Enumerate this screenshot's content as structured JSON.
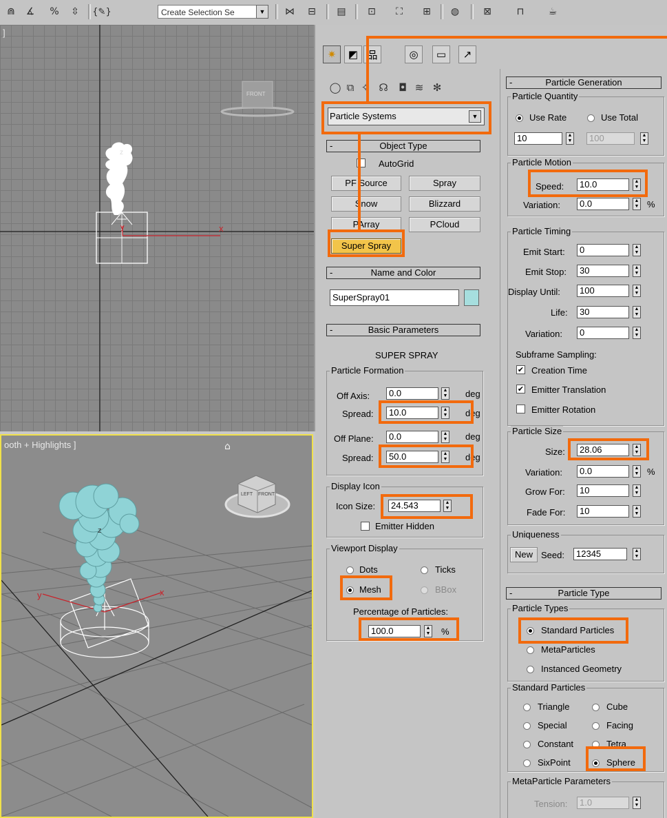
{
  "toolbar": {
    "selection_set_placeholder": "Create Selection Se",
    "icons": [
      "magnet-snap-icon",
      "angle-snap-icon",
      "percent-snap-icon",
      "spinner-snap-icon",
      "named-selection-edit-icon",
      "mirror-icon",
      "align-icon",
      "layer-manager-icon",
      "graphite-tools-icon",
      "curve-editor-icon",
      "schematic-view-icon",
      "material-editor-icon",
      "render-setup-icon",
      "rendered-frame-icon",
      "render-production-icon"
    ]
  },
  "viewports": {
    "front": {
      "label": "]",
      "axis_x": "x",
      "axis_y": "y",
      "axis_z": "z",
      "viewcube_label": "FRONT"
    },
    "perspective": {
      "label": "ooth + Highlights ]",
      "axis_x": "x",
      "axis_y": "y",
      "axis_z": "z",
      "viewcube_face_front": "FRONT",
      "viewcube_face_left": "LEFT"
    }
  },
  "command_panel": {
    "dropdown_value": "Particle Systems",
    "object_type": {
      "title": "Object Type",
      "autogrid_label": "AutoGrid",
      "buttons": [
        "PF Source",
        "Spray",
        "Snow",
        "Blizzard",
        "PArray",
        "PCloud",
        "Super Spray"
      ]
    },
    "name_color": {
      "title": "Name and Color",
      "name_value": "SuperSpray01",
      "color": "#a6dede"
    },
    "basic_params": {
      "title": "Basic Parameters",
      "heading": "SUPER SPRAY",
      "particle_formation": "Particle Formation",
      "off_axis_label": "Off Axis:",
      "off_axis_value": "0.0",
      "spread1_label": "Spread:",
      "spread1_value": "10.0",
      "off_plane_label": "Off Plane:",
      "off_plane_value": "0.0",
      "spread2_label": "Spread:",
      "spread2_value": "50.0",
      "deg": "deg",
      "display_icon": "Display Icon",
      "icon_size_label": "Icon Size:",
      "icon_size_value": "24.543",
      "emitter_hidden_label": "Emitter Hidden",
      "viewport_display": "Viewport Display",
      "dots": "Dots",
      "ticks": "Ticks",
      "mesh": "Mesh",
      "bbox": "BBox",
      "percentage_label": "Percentage of Particles:",
      "percentage_value": "100.0",
      "percent": "%"
    },
    "particle_generation": {
      "title": "Particle Generation",
      "quantity": "Particle Quantity",
      "use_rate": "Use Rate",
      "use_total": "Use Total",
      "rate_value": "10",
      "total_value": "100",
      "motion": "Particle Motion",
      "speed_label": "Speed:",
      "speed_value": "10.0",
      "variation_label": "Variation:",
      "variation_value": "0.0",
      "percent": "%",
      "timing": "Particle Timing",
      "emit_start_label": "Emit Start:",
      "emit_start_value": "0",
      "emit_stop_label": "Emit Stop:",
      "emit_stop_value": "30",
      "display_until_label": "Display Until:",
      "display_until_value": "100",
      "life_label": "Life:",
      "life_value": "30",
      "timing_variation_label": "Variation:",
      "timing_variation_value": "0",
      "subframe_label": "Subframe Sampling:",
      "creation_time": "Creation Time",
      "emitter_translation": "Emitter Translation",
      "emitter_rotation": "Emitter Rotation",
      "size_group": "Particle Size",
      "size_label": "Size:",
      "size_value": "28.06",
      "size_variation_label": "Variation:",
      "size_variation_value": "0.0",
      "grow_label": "Grow For:",
      "grow_value": "10",
      "fade_label": "Fade For:",
      "fade_value": "10",
      "uniqueness": "Uniqueness",
      "new_button": "New",
      "seed_label": "Seed:",
      "seed_value": "12345"
    },
    "particle_type": {
      "title": "Particle Type",
      "types_group": "Particle Types",
      "standard": "Standard Particles",
      "meta": "MetaParticles",
      "instanced": "Instanced Geometry",
      "standard_group": "Standard Particles",
      "triangle": "Triangle",
      "cube": "Cube",
      "special": "Special",
      "facing": "Facing",
      "constant": "Constant",
      "tetra": "Tetra",
      "sixpoint": "SixPoint",
      "sphere": "Sphere",
      "meta_params": "MetaParticle Parameters",
      "tension_label": "Tension:",
      "tension_value": "1.0"
    }
  },
  "colors": {
    "highlight": "#f26a0d",
    "active_button": "#f2c44a",
    "viewport_border_active": "#f0e14a",
    "particles": "#8fd3d6"
  }
}
